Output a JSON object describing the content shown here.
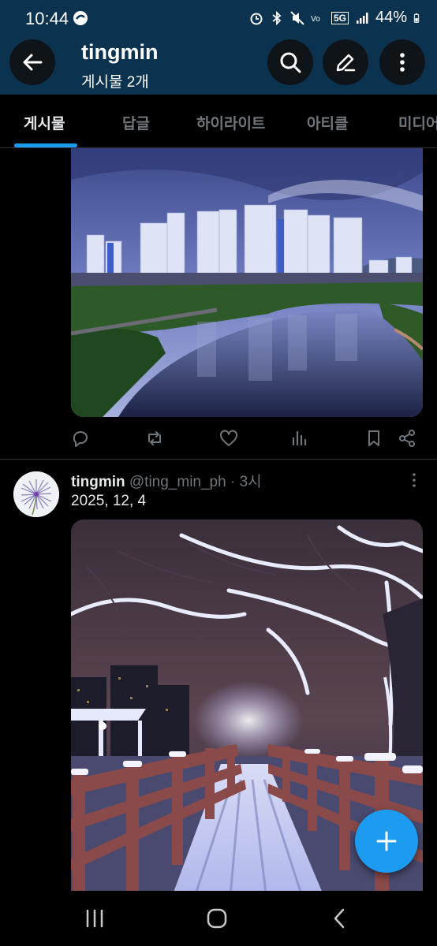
{
  "status_bar": {
    "time": "10:44",
    "network": "5G",
    "battery": "44%"
  },
  "header": {
    "title": "tingmin",
    "subtitle": "게시물 2개"
  },
  "tabs": [
    {
      "label": "게시물",
      "active": true
    },
    {
      "label": "답글",
      "active": false
    },
    {
      "label": "하이라이트",
      "active": false
    },
    {
      "label": "아티클",
      "active": false
    },
    {
      "label": "미디어",
      "active": false
    }
  ],
  "post2": {
    "name": "tingmin",
    "handle": "@ting_min_ph",
    "separator": " · ",
    "time": "3시",
    "text": "2025, 12, 4"
  },
  "colors": {
    "header_bg": "#0b3350",
    "accent": "#1d9bf0",
    "background": "#000000"
  }
}
